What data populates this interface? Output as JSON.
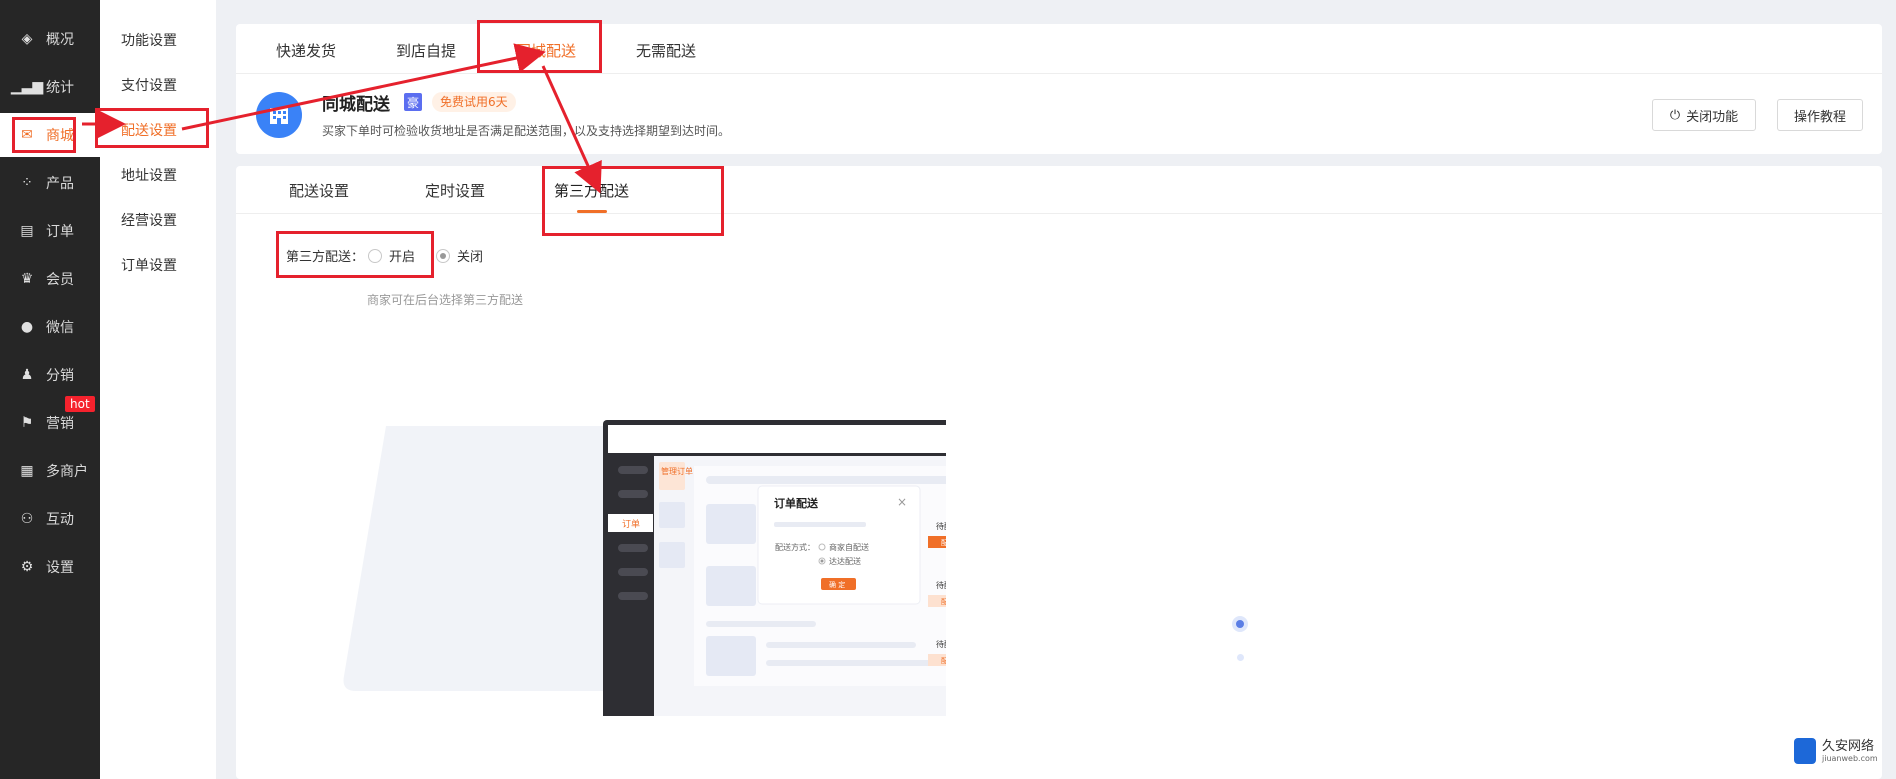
{
  "sidebar": {
    "items": [
      {
        "label": "概况",
        "icon": "layers-icon"
      },
      {
        "label": "统计",
        "icon": "chart-icon"
      },
      {
        "label": "商城",
        "icon": "shop-icon"
      },
      {
        "label": "产品",
        "icon": "product-icon"
      },
      {
        "label": "订单",
        "icon": "order-icon"
      },
      {
        "label": "会员",
        "icon": "crown-icon"
      },
      {
        "label": "微信",
        "icon": "wechat-icon"
      },
      {
        "label": "分销",
        "icon": "distribution-icon"
      },
      {
        "label": "营销",
        "icon": "flag-icon"
      },
      {
        "label": "多商户",
        "icon": "store-icon"
      },
      {
        "label": "互动",
        "icon": "users-icon"
      },
      {
        "label": "设置",
        "icon": "gear-icon"
      }
    ],
    "hot_badge": "hot",
    "active_color": "#f06f28"
  },
  "subnav": {
    "items": [
      "功能设置",
      "支付设置",
      "配送设置",
      "地址设置",
      "经营设置",
      "订单设置"
    ]
  },
  "delivery_tabs": [
    "快递发货",
    "到店自提",
    "同城配送",
    "无需配送"
  ],
  "feature": {
    "title": "同城配送",
    "badge": "豪",
    "trial": "免费试用6天",
    "description": "买家下单时可检验收货地址是否满足配送范围，以及支持选择期望到达时间。",
    "close_button": "关闭功能",
    "tutorial_button": "操作教程"
  },
  "settings_tabs": [
    "配送设置",
    "定时设置",
    "第三方配送"
  ],
  "form": {
    "label": "第三方配送：",
    "option_on": "开启",
    "option_off": "关闭",
    "selected": "关闭",
    "hint": "商家可在后台选择第三方配送"
  },
  "illustration": {
    "side_tag": "管理订单",
    "menu_order": "订单",
    "dialog_title": "订单配送",
    "method_label": "配送方式：",
    "method_option_1": "商家自配送",
    "method_option_2": "达达配送",
    "confirm": "确 定",
    "status_1": "待配送",
    "status_2": "待配送",
    "status_3": "待配送",
    "action_1": "配送",
    "action_2": "配送",
    "action_3": "配送"
  },
  "watermark": {
    "name": "久安网络",
    "sub": "jiuanweb.com"
  },
  "colors": {
    "accent": "#f06f28",
    "annotation": "#e5212d",
    "sidebar_bg": "#262626"
  }
}
